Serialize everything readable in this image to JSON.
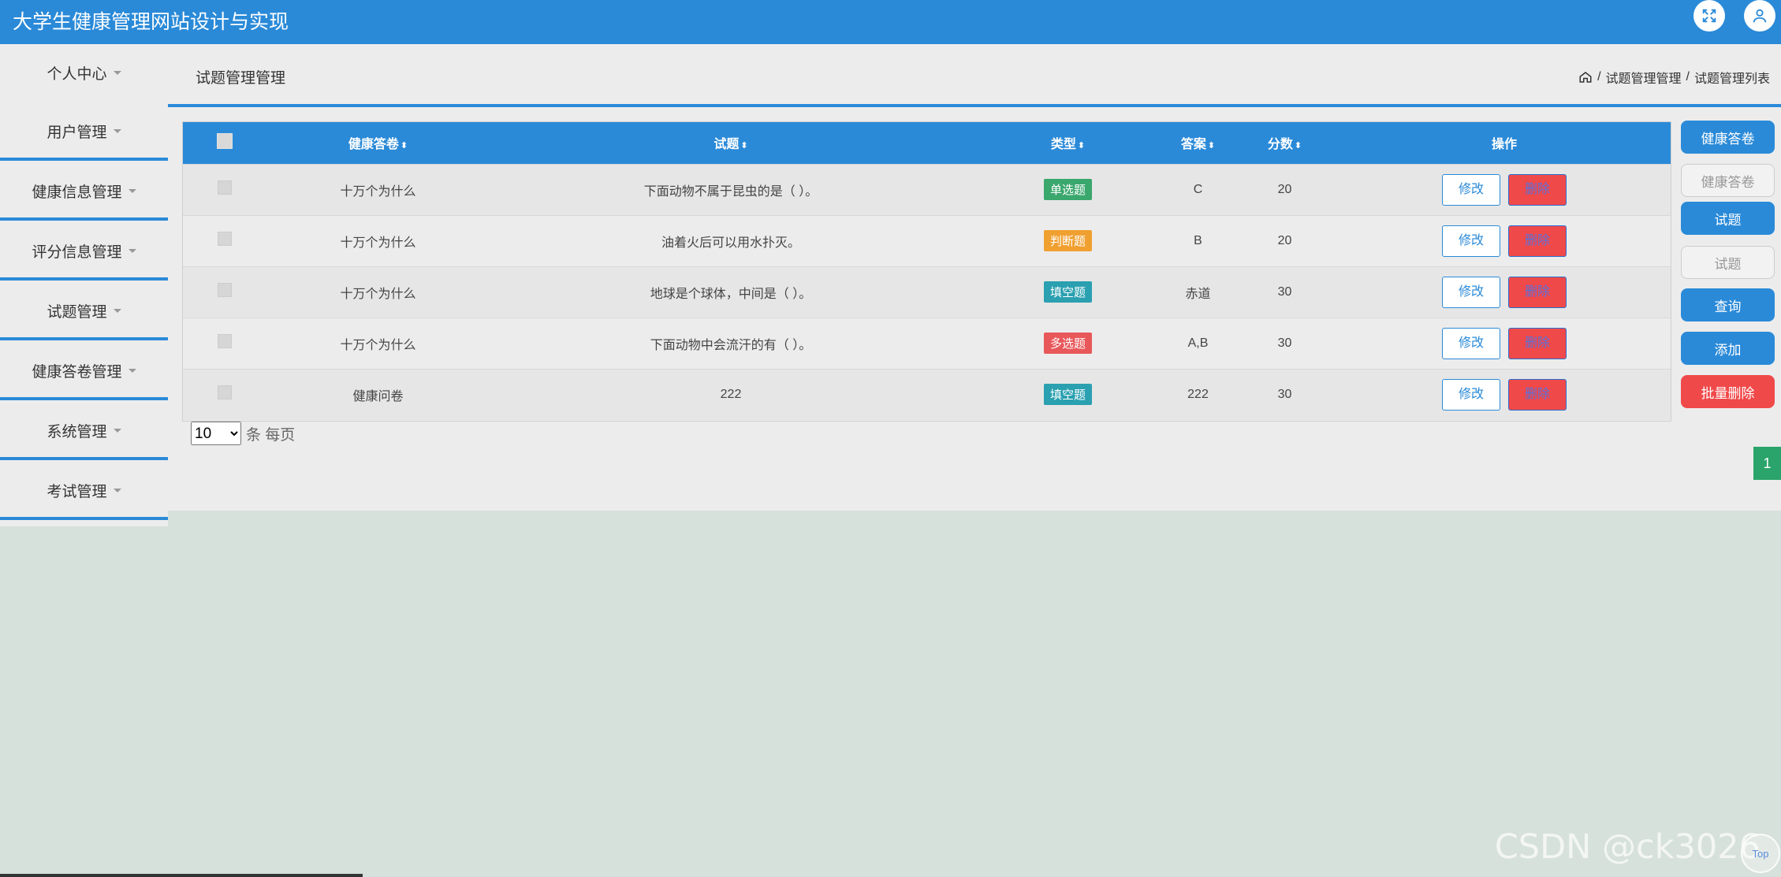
{
  "header": {
    "title": "大学生健康管理网站设计与实现"
  },
  "sidebar": {
    "items": [
      {
        "label": "个人中心"
      },
      {
        "label": "用户管理"
      },
      {
        "label": "健康信息管理"
      },
      {
        "label": "评分信息管理"
      },
      {
        "label": "试题管理"
      },
      {
        "label": "健康答卷管理"
      },
      {
        "label": "系统管理"
      },
      {
        "label": "考试管理"
      }
    ]
  },
  "page": {
    "title": "试题管理管理",
    "breadcrumb": [
      "试题管理管理",
      "试题管理列表"
    ]
  },
  "table": {
    "columns": [
      "健康答卷",
      "试题",
      "类型",
      "答案",
      "分数",
      "操作"
    ],
    "edit_label": "修改",
    "delete_label": "删除",
    "rows": [
      {
        "paper": "十万个为什么",
        "question": "下面动物不属于昆虫的是（ ）。",
        "type": "单选题",
        "type_color": "#3aa76d",
        "answer": "C",
        "score": "20"
      },
      {
        "paper": "十万个为什么",
        "question": "油着火后可以用水扑灭。",
        "type": "判断题",
        "type_color": "#f0a030",
        "answer": "B",
        "score": "20"
      },
      {
        "paper": "十万个为什么",
        "question": "地球是个球体，中间是（ ）。",
        "type": "填空题",
        "type_color": "#2aa0b0",
        "answer": "赤道",
        "score": "30"
      },
      {
        "paper": "十万个为什么",
        "question": "下面动物中会流汗的有（ ）。",
        "type": "多选题",
        "type_color": "#e8585a",
        "answer": "A,B",
        "score": "30"
      },
      {
        "paper": "健康问卷",
        "question": "222",
        "type": "填空题",
        "type_color": "#2aa0b0",
        "answer": "222",
        "score": "30"
      }
    ]
  },
  "pager": {
    "page_size": "10",
    "unit_label": "条 每页",
    "current_page": "1"
  },
  "right_panel": {
    "btn_paper": "健康答卷",
    "input_paper_placeholder": "健康答卷",
    "btn_question": "试题",
    "input_question_placeholder": "试题",
    "btn_search": "查询",
    "btn_add": "添加",
    "btn_batch_delete": "批量删除"
  },
  "watermark": "CSDN @ck3026",
  "top_button": "Top",
  "colors": {
    "primary": "#2a8ad8",
    "danger": "#f0494a",
    "success": "#2aa46a"
  }
}
